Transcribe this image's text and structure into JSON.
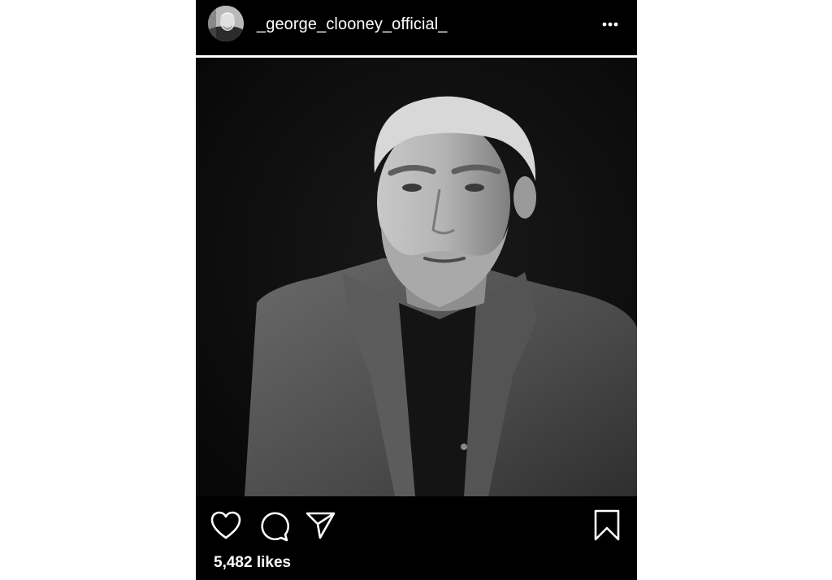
{
  "post": {
    "username": "_george_clooney_official_",
    "likes_label": "5,482 likes"
  },
  "icons": {
    "avatar": "profile-photo",
    "more": "more-horizontal-icon",
    "like": "heart-icon",
    "comment": "comment-icon",
    "share": "send-icon",
    "save": "bookmark-icon"
  },
  "colors": {
    "background": "#000000",
    "page": "#ffffff",
    "text": "#ffffff",
    "photo_bg": "#0f0f0f"
  }
}
